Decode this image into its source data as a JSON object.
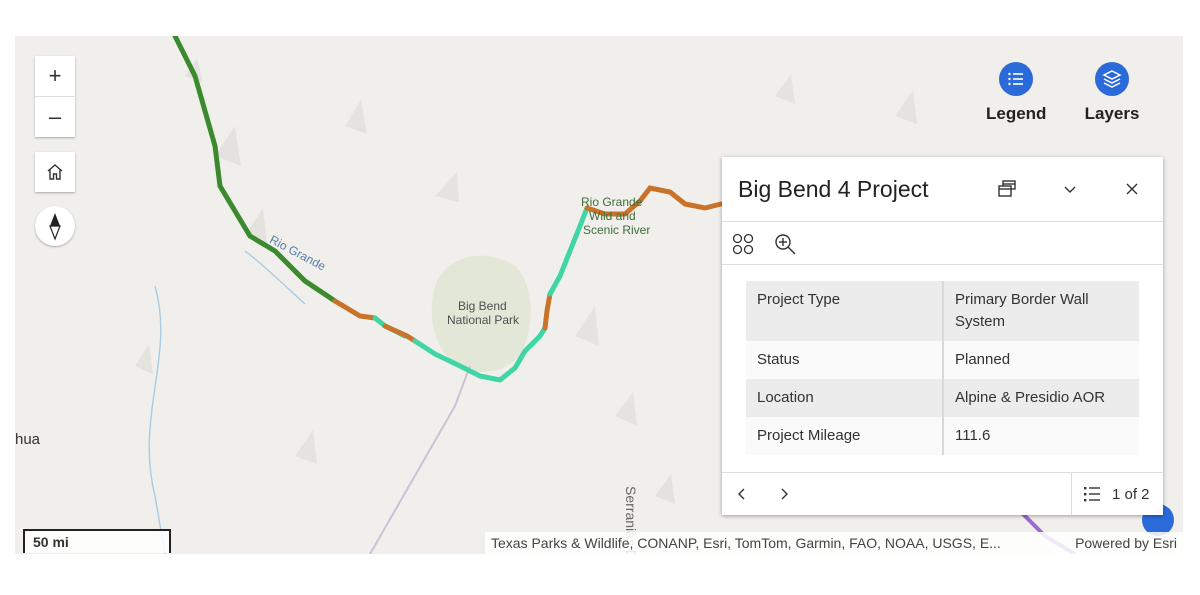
{
  "map": {
    "labels": {
      "rio_grande_river": "Rio Grande",
      "rio_grande_wsr_1": "Rio Grande",
      "rio_grande_wsr_2": "Wild and",
      "rio_grande_wsr_3": "Scenic River",
      "park_1": "Big Bend",
      "park_2": "National Park",
      "city_partial": "hua",
      "mountains": "Serranias Del"
    },
    "line_colors": {
      "completed": "#3c8a2e",
      "planned_orange": "#c8722a",
      "planned_teal": "#3fd5a5"
    }
  },
  "controls": {
    "zoom_in": "+",
    "zoom_out": "–",
    "home_icon": "home-icon",
    "compass_icon": "compass-icon",
    "legend_label": "Legend",
    "layers_label": "Layers",
    "accent": "#2b6ad9"
  },
  "scalebar": {
    "label": "50 mi"
  },
  "attribution": {
    "sources": "Texas Parks & Wildlife, CONANP, Esri, TomTom, Garmin, FAO, NOAA, USGS, E...",
    "powered_by": "Powered by Esri"
  },
  "popup": {
    "title": "Big Bend 4 Project",
    "fields": [
      {
        "label": "Project Type",
        "value": "Primary Border Wall System"
      },
      {
        "label": "Status",
        "value": "Planned"
      },
      {
        "label": "Location",
        "value": "Alpine & Presidio AOR"
      },
      {
        "label": "Project Mileage",
        "value": "111.6"
      }
    ],
    "pager": "1 of 2"
  }
}
